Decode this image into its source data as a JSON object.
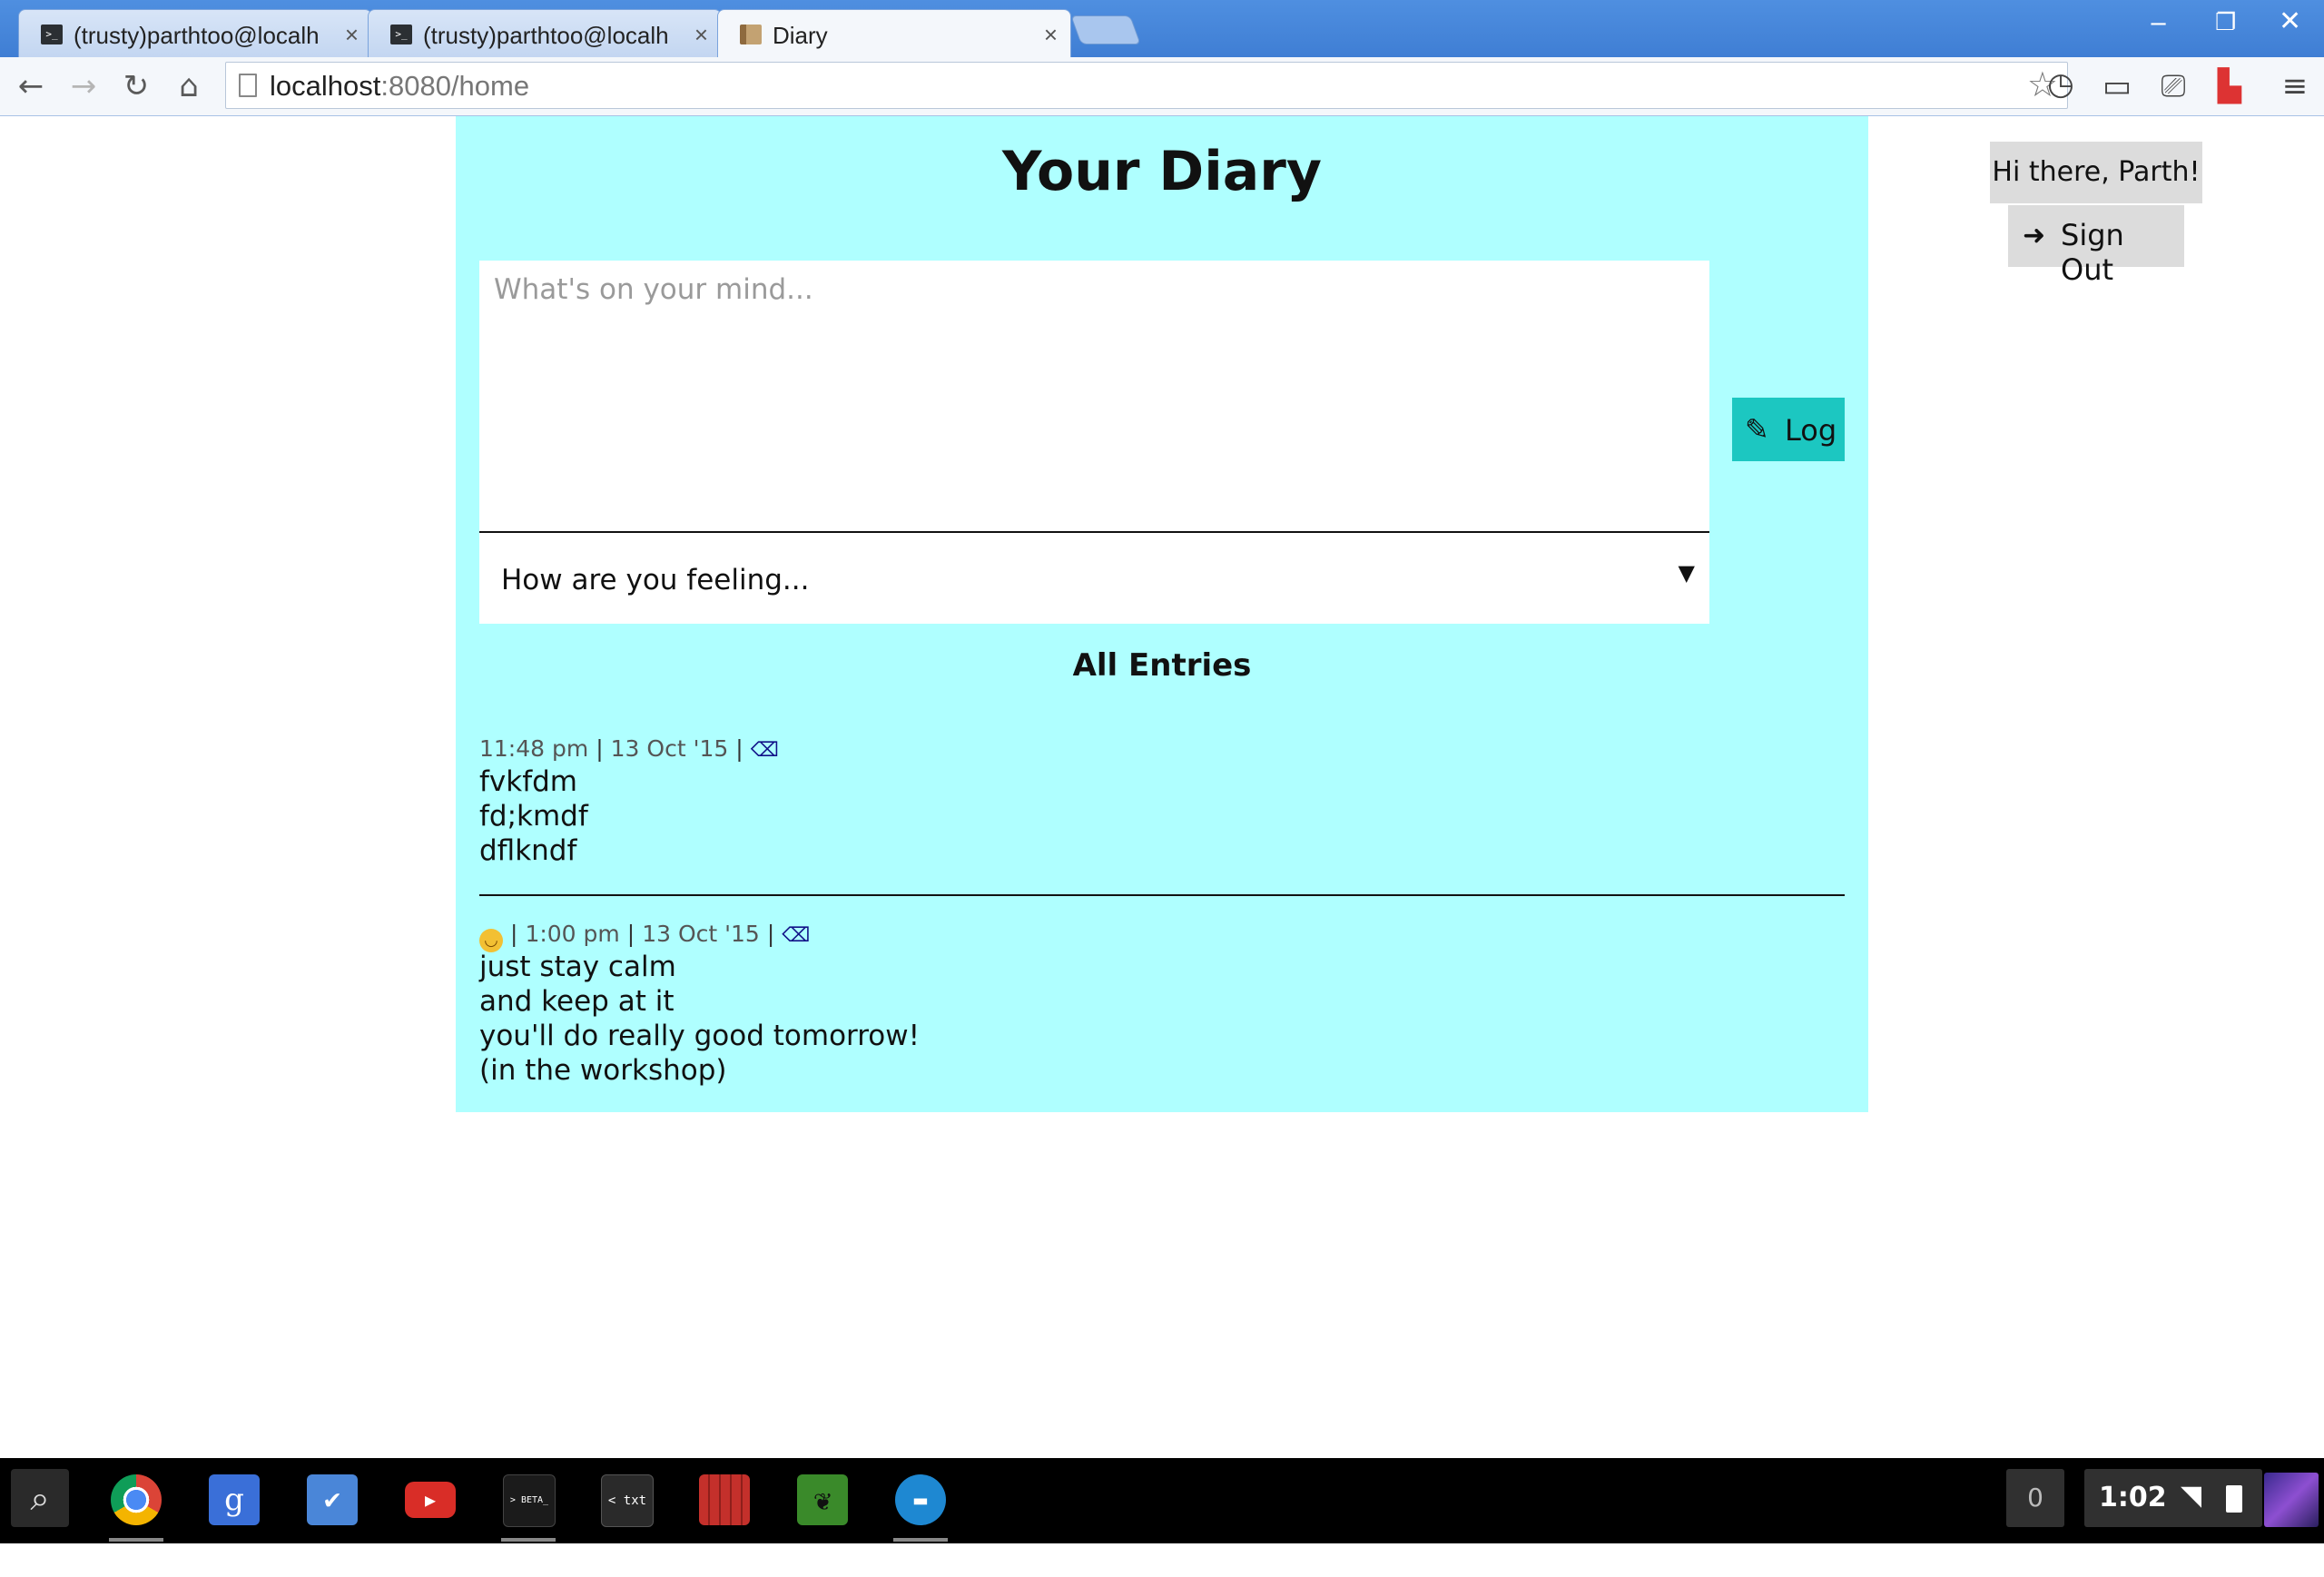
{
  "browser": {
    "tabs": [
      {
        "title": "(trusty)parthtoo@localh",
        "favicon": "terminal-icon"
      },
      {
        "title": "(trusty)parthtoo@localh",
        "favicon": "terminal-icon"
      },
      {
        "title": "Diary",
        "favicon": "diary-icon"
      }
    ],
    "tab_close": "×",
    "url_host": "localhost",
    "url_rest": ":8080/home"
  },
  "page": {
    "heading": "Your Diary",
    "entry_placeholder": "What's on your mind...",
    "mood_label": "How are you feeling...",
    "mood_arrow": "▼",
    "log_label": "Log",
    "entries_title": "All Entries",
    "greeting": "Hi there, Parth!",
    "sign_out_label": "Sign Out",
    "entries": [
      {
        "mood_icon": "",
        "time": "11:48 pm",
        "date": "13 Oct '15",
        "lines": [
          "fvkfdm",
          "fd;kmdf",
          "dflkndf"
        ]
      },
      {
        "mood_icon": "smile-emoji-icon",
        "time": "1:00 pm",
        "date": "13 Oct '15",
        "lines": [
          "just stay calm",
          "and keep at it",
          "you'll do really good tomorrow!",
          "(in the workshop)"
        ]
      }
    ]
  },
  "shelf": {
    "apps": [
      "search-icon",
      "chrome-icon",
      "google-search-icon",
      "inbox-icon",
      "youtube-icon",
      "terminal-beta-icon",
      "text-editor-icon",
      "video-player-icon",
      "music-app-icon",
      "files-icon"
    ],
    "text_editor_label": "< txt >",
    "terminal_label": "> BETA_",
    "notification_count": "0",
    "clock": "1:02"
  },
  "colors": {
    "diary_background": "#afffff",
    "log_button": "#1cc7c1",
    "chrome_frame": "#3f7ed4"
  }
}
